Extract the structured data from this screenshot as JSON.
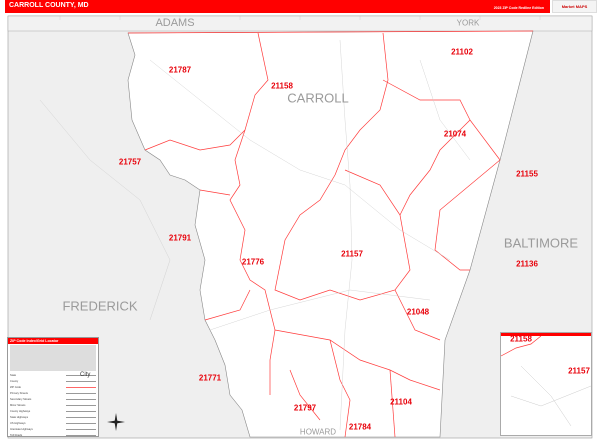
{
  "header": {
    "title": "CARROLL COUNTY, MD",
    "edition": "2023 ZIP Code Redline Edition",
    "logo": "Market MAPS"
  },
  "regions": {
    "adams": "ADAMS",
    "york": "YORK",
    "carroll": "CARROLL",
    "baltimore": "BALTIMORE",
    "frederick": "FREDERICK",
    "howard": "HOWARD"
  },
  "zip_labels": [
    "21787",
    "21158",
    "21102",
    "21074",
    "21757",
    "21155",
    "21791",
    "21776",
    "21157",
    "21136",
    "21048",
    "21771",
    "21797",
    "21104",
    "21784"
  ],
  "inset": {
    "zip_labels": [
      "21158",
      "21157"
    ]
  },
  "legend": {
    "title": "ZIP Code Index/Grid Locator",
    "items": [
      "State",
      "County",
      "ZIP Code",
      "Primary Streets",
      "Secondary Streets",
      "Minor Streets",
      "County Highways",
      "State Highways",
      "US Highways",
      "Interstate Highways",
      "Toll Roads"
    ],
    "city_label": "City"
  },
  "colors": {
    "accent": "#ff0000",
    "zip_line": "#ff3b3b",
    "outside": "#efefef"
  }
}
